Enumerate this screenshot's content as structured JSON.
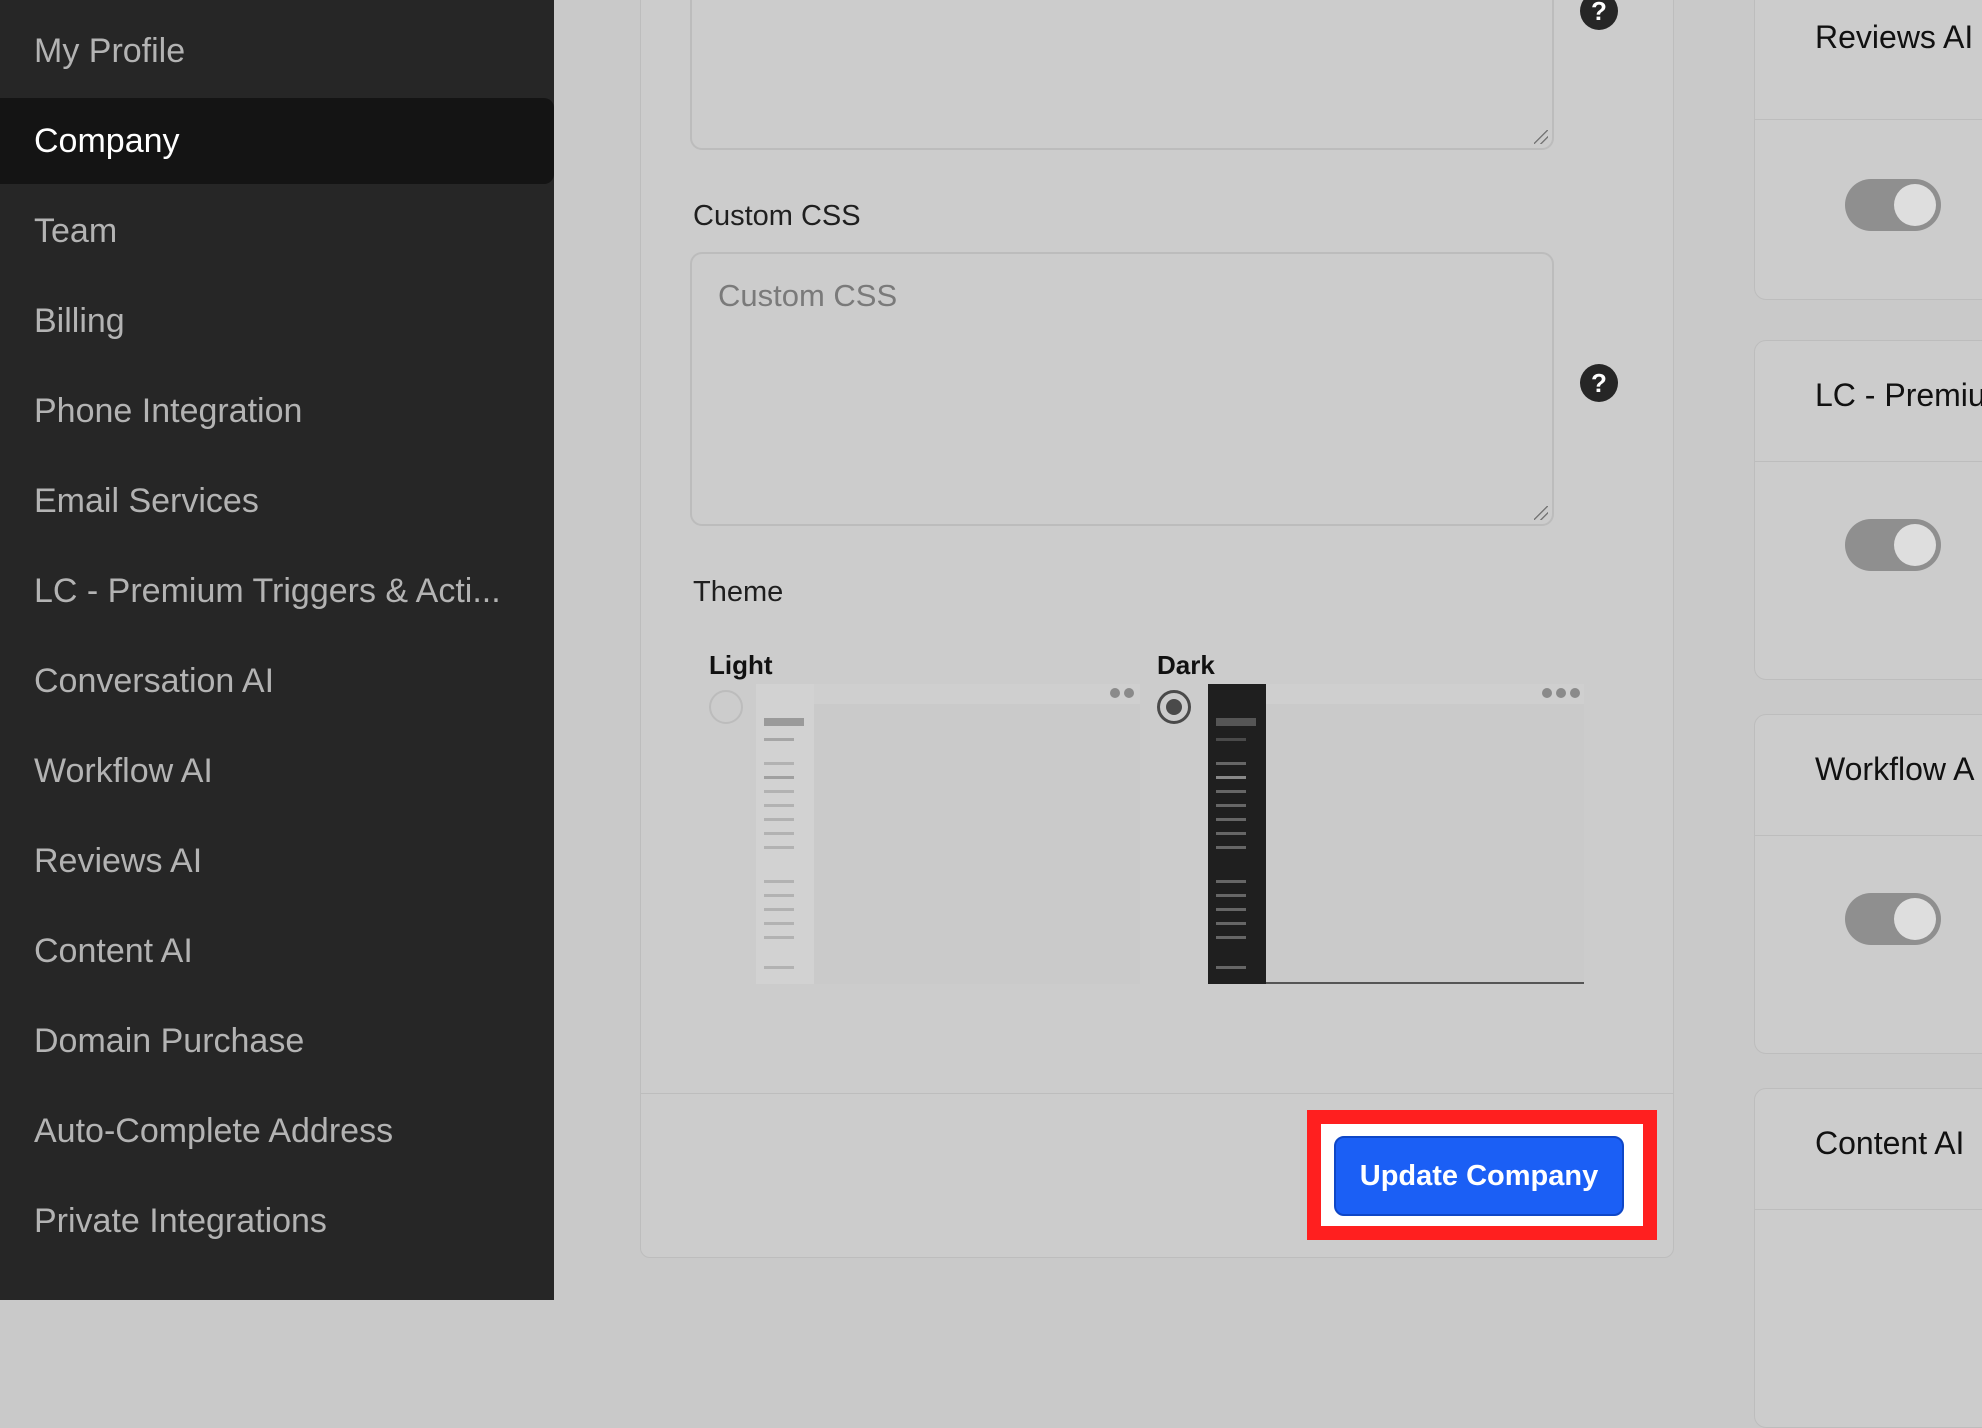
{
  "sidebar": {
    "items": [
      {
        "label": "My Profile",
        "active": false
      },
      {
        "label": "Company",
        "active": true
      },
      {
        "label": "Team",
        "active": false
      },
      {
        "label": "Billing",
        "active": false
      },
      {
        "label": "Phone Integration",
        "active": false
      },
      {
        "label": "Email Services",
        "active": false
      },
      {
        "label": "LC - Premium Triggers & Acti...",
        "active": false
      },
      {
        "label": "Conversation AI",
        "active": false
      },
      {
        "label": "Workflow AI",
        "active": false
      },
      {
        "label": "Reviews AI",
        "active": false
      },
      {
        "label": "Content AI",
        "active": false
      },
      {
        "label": "Domain Purchase",
        "active": false
      },
      {
        "label": "Auto-Complete Address",
        "active": false
      },
      {
        "label": "Private Integrations",
        "active": false
      }
    ]
  },
  "form": {
    "custom_css_label": "Custom CSS",
    "custom_css_placeholder": "Custom CSS",
    "custom_css_value": "",
    "theme_label": "Theme",
    "theme_options": [
      {
        "label": "Light",
        "selected": false
      },
      {
        "label": "Dark",
        "selected": true
      }
    ],
    "help_icon_glyph": "?"
  },
  "footer": {
    "update_button_label": "Update Company"
  },
  "right_cards": [
    {
      "title": "Reviews AI",
      "toggle_on": true
    },
    {
      "title": "LC - Premiu",
      "toggle_on": true
    },
    {
      "title": "Workflow A",
      "toggle_on": true
    },
    {
      "title": "Content AI",
      "toggle_on": true
    }
  ],
  "colors": {
    "accent": "#1b5ff5",
    "highlight": "#ff1f1f",
    "sidebar_bg": "#262626",
    "sidebar_active_bg": "#141414"
  }
}
